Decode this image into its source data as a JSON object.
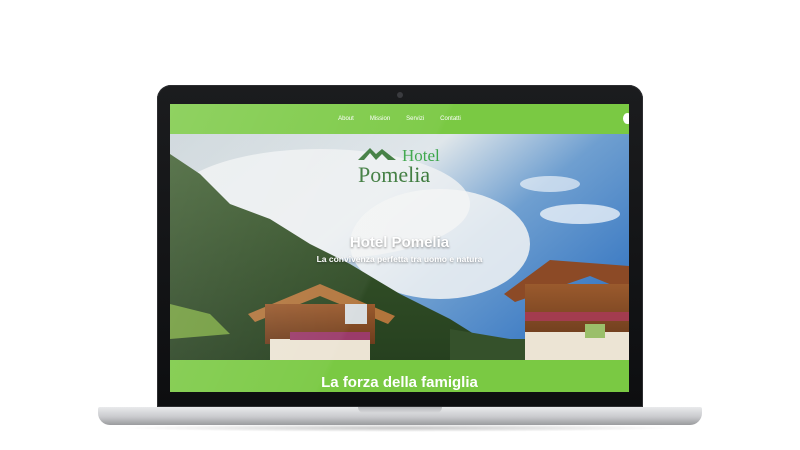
{
  "nav": {
    "items": [
      {
        "label": "About"
      },
      {
        "label": "Mission"
      },
      {
        "label": "Servizi"
      },
      {
        "label": "Contatti"
      }
    ]
  },
  "logo": {
    "word1": "Hotel",
    "word2": "Pomelia",
    "icon": "mountain-icon"
  },
  "hero": {
    "title": "Hotel Pomelia",
    "subtitle": "La convivenza perfetta tra uomo e natura"
  },
  "section": {
    "title": "La forza della famiglia"
  },
  "colors": {
    "brand_green": "#7ac943",
    "logo_green": "#3c7a3c"
  }
}
